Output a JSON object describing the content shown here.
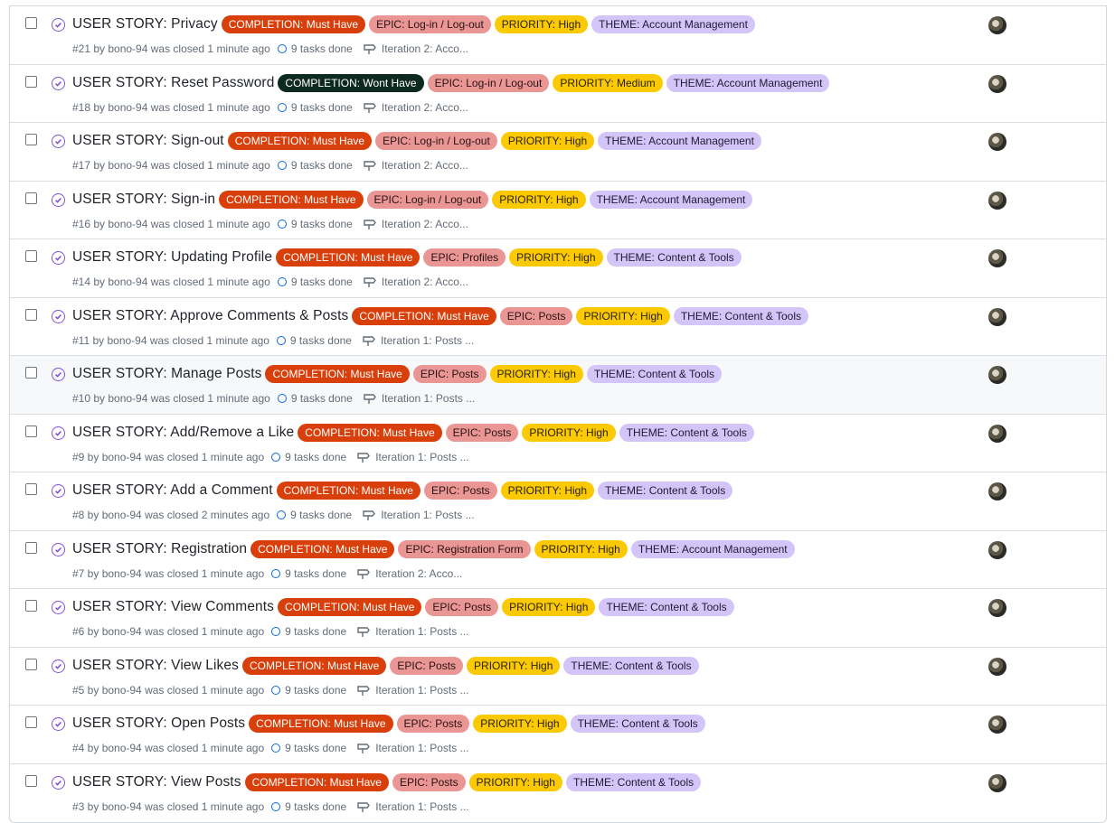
{
  "issues": [
    {
      "title": "USER STORY: Privacy",
      "completion": "COMPLETION: Must Have",
      "epic": "EPIC: Log-in / Log-out",
      "priority": "PRIORITY: High",
      "theme": "THEME: Account Management",
      "meta": "#21 by bono-94 was closed 1 minute ago",
      "tasks": "9 tasks done",
      "milestone": "Iteration 2: Acco..."
    },
    {
      "title": "USER STORY: Reset Password",
      "completion": "COMPLETION: Wont Have",
      "epic": "EPIC: Log-in / Log-out",
      "priority": "PRIORITY: Medium",
      "theme": "THEME: Account Management",
      "meta": "#18 by bono-94 was closed 1 minute ago",
      "tasks": "9 tasks done",
      "milestone": "Iteration 2: Acco..."
    },
    {
      "title": "USER STORY: Sign-out",
      "completion": "COMPLETION: Must Have",
      "epic": "EPIC: Log-in / Log-out",
      "priority": "PRIORITY: High",
      "theme": "THEME: Account Management",
      "meta": "#17 by bono-94 was closed 1 minute ago",
      "tasks": "9 tasks done",
      "milestone": "Iteration 2: Acco..."
    },
    {
      "title": "USER STORY: Sign-in",
      "completion": "COMPLETION: Must Have",
      "epic": "EPIC: Log-in / Log-out",
      "priority": "PRIORITY: High",
      "theme": "THEME: Account Management",
      "meta": "#16 by bono-94 was closed 1 minute ago",
      "tasks": "9 tasks done",
      "milestone": "Iteration 2: Acco..."
    },
    {
      "title": "USER STORY: Updating Profile",
      "completion": "COMPLETION: Must Have",
      "epic": "EPIC: Profiles",
      "priority": "PRIORITY: High",
      "theme": "THEME: Content & Tools",
      "meta": "#14 by bono-94 was closed 1 minute ago",
      "tasks": "9 tasks done",
      "milestone": "Iteration 2: Acco..."
    },
    {
      "title": "USER STORY: Approve Comments & Posts",
      "completion": "COMPLETION: Must Have",
      "epic": "EPIC: Posts",
      "priority": "PRIORITY: High",
      "theme": "THEME: Content & Tools",
      "meta": "#11 by bono-94 was closed 1 minute ago",
      "tasks": "9 tasks done",
      "milestone": "Iteration 1: Posts ..."
    },
    {
      "title": "USER STORY: Manage Posts",
      "completion": "COMPLETION: Must Have",
      "epic": "EPIC: Posts",
      "priority": "PRIORITY: High",
      "theme": "THEME: Content & Tools",
      "meta": "#10 by bono-94 was closed 1 minute ago",
      "tasks": "9 tasks done",
      "milestone": "Iteration 1: Posts ..."
    },
    {
      "title": "USER STORY: Add/Remove a Like",
      "completion": "COMPLETION: Must Have",
      "epic": "EPIC: Posts",
      "priority": "PRIORITY: High",
      "theme": "THEME: Content & Tools",
      "meta": "#9 by bono-94 was closed 1 minute ago",
      "tasks": "9 tasks done",
      "milestone": "Iteration 1: Posts ..."
    },
    {
      "title": "USER STORY: Add a Comment",
      "completion": "COMPLETION: Must Have",
      "epic": "EPIC: Posts",
      "priority": "PRIORITY: High",
      "theme": "THEME: Content & Tools",
      "meta": "#8 by bono-94 was closed 2 minutes ago",
      "tasks": "9 tasks done",
      "milestone": "Iteration 1: Posts ..."
    },
    {
      "title": "USER STORY: Registration",
      "completion": "COMPLETION: Must Have",
      "epic": "EPIC: Registration Form",
      "priority": "PRIORITY: High",
      "theme": "THEME: Account Management",
      "meta": "#7 by bono-94 was closed 1 minute ago",
      "tasks": "9 tasks done",
      "milestone": "Iteration 2: Acco..."
    },
    {
      "title": "USER STORY: View Comments",
      "completion": "COMPLETION: Must Have",
      "epic": "EPIC: Posts",
      "priority": "PRIORITY: High",
      "theme": "THEME: Content & Tools",
      "meta": "#6 by bono-94 was closed 1 minute ago",
      "tasks": "9 tasks done",
      "milestone": "Iteration 1: Posts ..."
    },
    {
      "title": "USER STORY: View Likes",
      "completion": "COMPLETION: Must Have",
      "epic": "EPIC: Posts",
      "priority": "PRIORITY: High",
      "theme": "THEME: Content & Tools",
      "meta": "#5 by bono-94 was closed 1 minute ago",
      "tasks": "9 tasks done",
      "milestone": "Iteration 1: Posts ..."
    },
    {
      "title": "USER STORY: Open Posts",
      "completion": "COMPLETION: Must Have",
      "epic": "EPIC: Posts",
      "priority": "PRIORITY: High",
      "theme": "THEME: Content & Tools",
      "meta": "#4 by bono-94 was closed 1 minute ago",
      "tasks": "9 tasks done",
      "milestone": "Iteration 1: Posts ..."
    },
    {
      "title": "USER STORY: View Posts",
      "completion": "COMPLETION: Must Have",
      "epic": "EPIC: Posts",
      "priority": "PRIORITY: High",
      "theme": "THEME: Content & Tools",
      "meta": "#3 by bono-94 was closed 1 minute ago",
      "tasks": "9 tasks done",
      "milestone": "Iteration 1: Posts ..."
    }
  ],
  "icons": {
    "state": "closed-issue-icon",
    "tasks": "tasks-progress-icon",
    "milestone": "milestone-icon",
    "avatar": "user-avatar"
  },
  "colors": {
    "completion": "#d93f0b",
    "completion_wont": "#0e2a1f",
    "epic": "#e99695",
    "priority": "#fbca04",
    "theme": "#d4c5f9",
    "closed_state": "#8250df",
    "link": "#0969da"
  }
}
